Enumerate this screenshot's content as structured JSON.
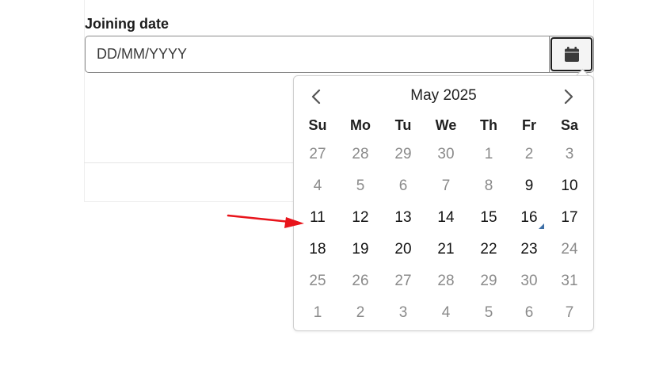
{
  "form": {
    "label": "Joining date",
    "input_placeholder": "DD/MM/YYYY",
    "input_value": "",
    "calendar_button_icon": "calendar-icon"
  },
  "datepicker": {
    "title": "May 2025",
    "prev_icon": "chevron-left-icon",
    "next_icon": "chevron-right-icon",
    "weekdays": [
      "Su",
      "Mo",
      "Tu",
      "We",
      "Th",
      "Fr",
      "Sa"
    ],
    "weeks": [
      [
        {
          "d": "27",
          "muted": true
        },
        {
          "d": "28",
          "muted": true
        },
        {
          "d": "29",
          "muted": true
        },
        {
          "d": "30",
          "muted": true
        },
        {
          "d": "1",
          "muted": true
        },
        {
          "d": "2",
          "muted": true
        },
        {
          "d": "3",
          "muted": true
        }
      ],
      [
        {
          "d": "4",
          "muted": true
        },
        {
          "d": "5",
          "muted": true
        },
        {
          "d": "6",
          "muted": true
        },
        {
          "d": "7",
          "muted": true
        },
        {
          "d": "8",
          "muted": true
        },
        {
          "d": "9",
          "muted": false
        },
        {
          "d": "10",
          "muted": false
        }
      ],
      [
        {
          "d": "11",
          "muted": false
        },
        {
          "d": "12",
          "muted": false
        },
        {
          "d": "13",
          "muted": false
        },
        {
          "d": "14",
          "muted": false
        },
        {
          "d": "15",
          "muted": false
        },
        {
          "d": "16",
          "muted": false,
          "today": true
        },
        {
          "d": "17",
          "muted": false
        }
      ],
      [
        {
          "d": "18",
          "muted": false
        },
        {
          "d": "19",
          "muted": false
        },
        {
          "d": "20",
          "muted": false
        },
        {
          "d": "21",
          "muted": false
        },
        {
          "d": "22",
          "muted": false
        },
        {
          "d": "23",
          "muted": false
        },
        {
          "d": "24",
          "muted": true
        }
      ],
      [
        {
          "d": "25",
          "muted": true
        },
        {
          "d": "26",
          "muted": true
        },
        {
          "d": "27",
          "muted": true
        },
        {
          "d": "28",
          "muted": true
        },
        {
          "d": "29",
          "muted": true
        },
        {
          "d": "30",
          "muted": true
        },
        {
          "d": "31",
          "muted": true
        }
      ],
      [
        {
          "d": "1",
          "muted": true
        },
        {
          "d": "2",
          "muted": true
        },
        {
          "d": "3",
          "muted": true
        },
        {
          "d": "4",
          "muted": true
        },
        {
          "d": "5",
          "muted": true
        },
        {
          "d": "6",
          "muted": true
        },
        {
          "d": "7",
          "muted": true
        }
      ]
    ],
    "today_marker_color": "#3e6fa6"
  },
  "annotation": {
    "arrow_color": "#e8141b",
    "arrow_icon": "red-arrow-annotation-icon"
  }
}
